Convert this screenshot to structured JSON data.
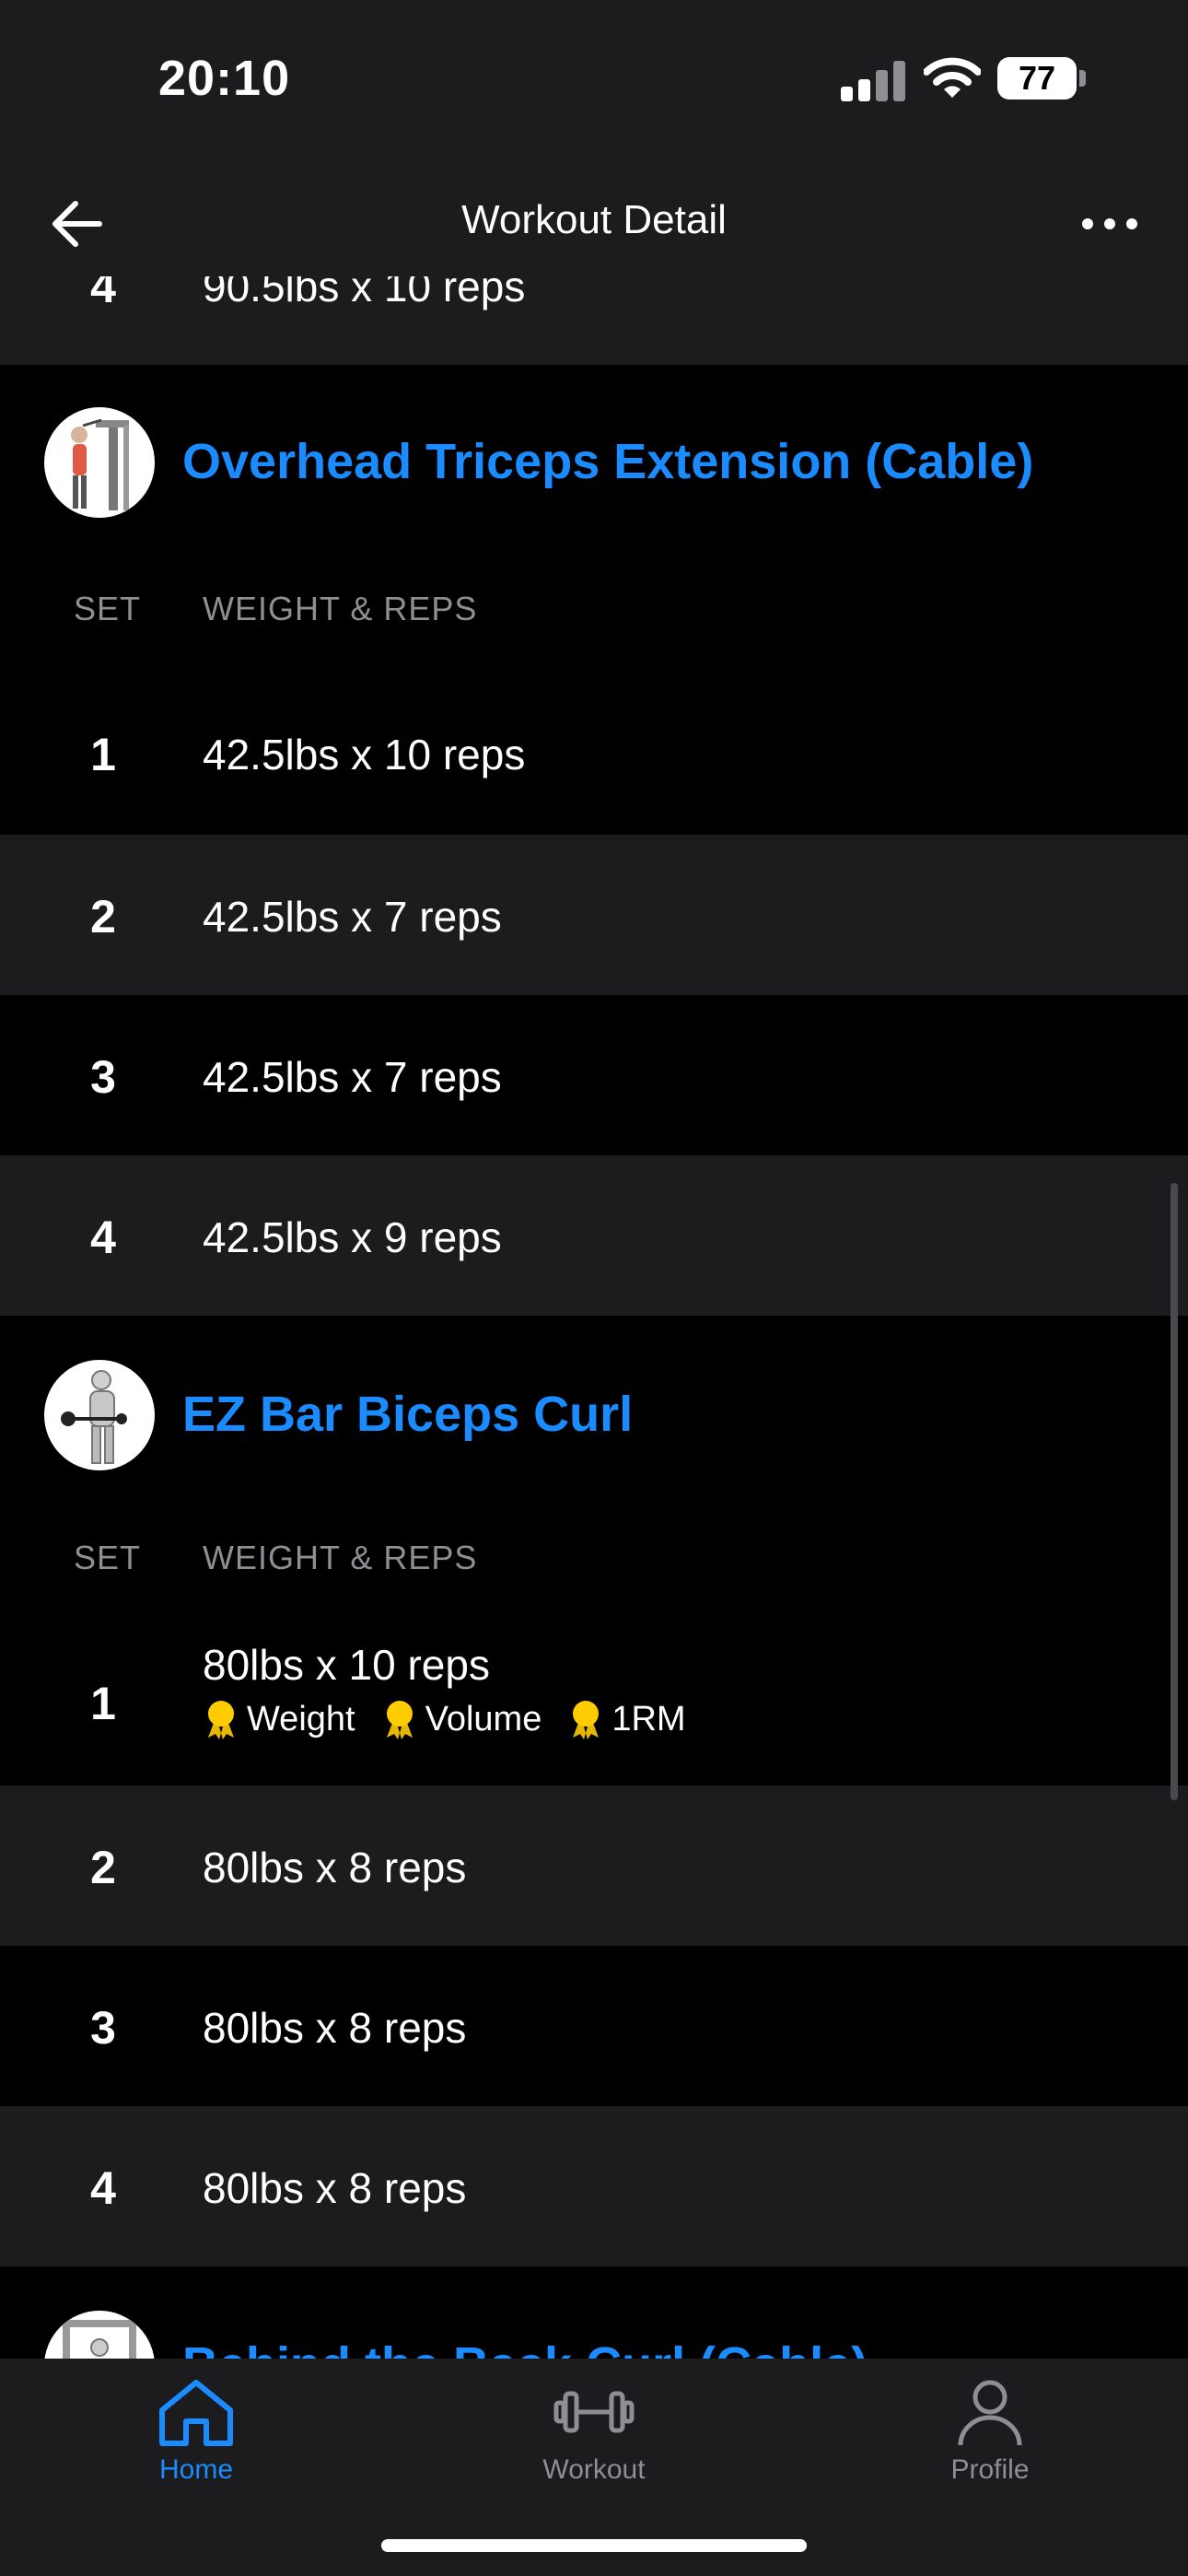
{
  "status_bar": {
    "time": "20:10",
    "battery": "77"
  },
  "header": {
    "title": "Workout Detail"
  },
  "columns": {
    "set": "SET",
    "weight_reps": "WEIGHT & REPS"
  },
  "previous_exercise": {
    "last_set": {
      "set": "4",
      "text": "90.5lbs x 10 reps"
    }
  },
  "exercises": [
    {
      "name": "Overhead Triceps Extension (Cable)",
      "sets": [
        {
          "set": "1",
          "text": "42.5lbs x 10 reps"
        },
        {
          "set": "2",
          "text": "42.5lbs x 7 reps"
        },
        {
          "set": "3",
          "text": "42.5lbs x 7 reps"
        },
        {
          "set": "4",
          "text": "42.5lbs x 9 reps"
        }
      ]
    },
    {
      "name": "EZ Bar Biceps Curl",
      "sets": [
        {
          "set": "1",
          "text": "80lbs x 10 reps",
          "records": [
            "Weight",
            "Volume",
            "1RM"
          ]
        },
        {
          "set": "2",
          "text": "80lbs x 8 reps"
        },
        {
          "set": "3",
          "text": "80lbs x 8 reps"
        },
        {
          "set": "4",
          "text": "80lbs x 8 reps"
        }
      ]
    },
    {
      "name": "Behind the Back Curl (Cable)"
    }
  ],
  "tab_bar": {
    "home": "Home",
    "workout": "Workout",
    "profile": "Profile",
    "active_color": "#1a8cff",
    "inactive_color": "#8e8e93"
  },
  "icons": [
    "back-arrow-icon",
    "more-icon",
    "medal-icon",
    "home-icon",
    "dumbbell-icon",
    "person-icon"
  ]
}
